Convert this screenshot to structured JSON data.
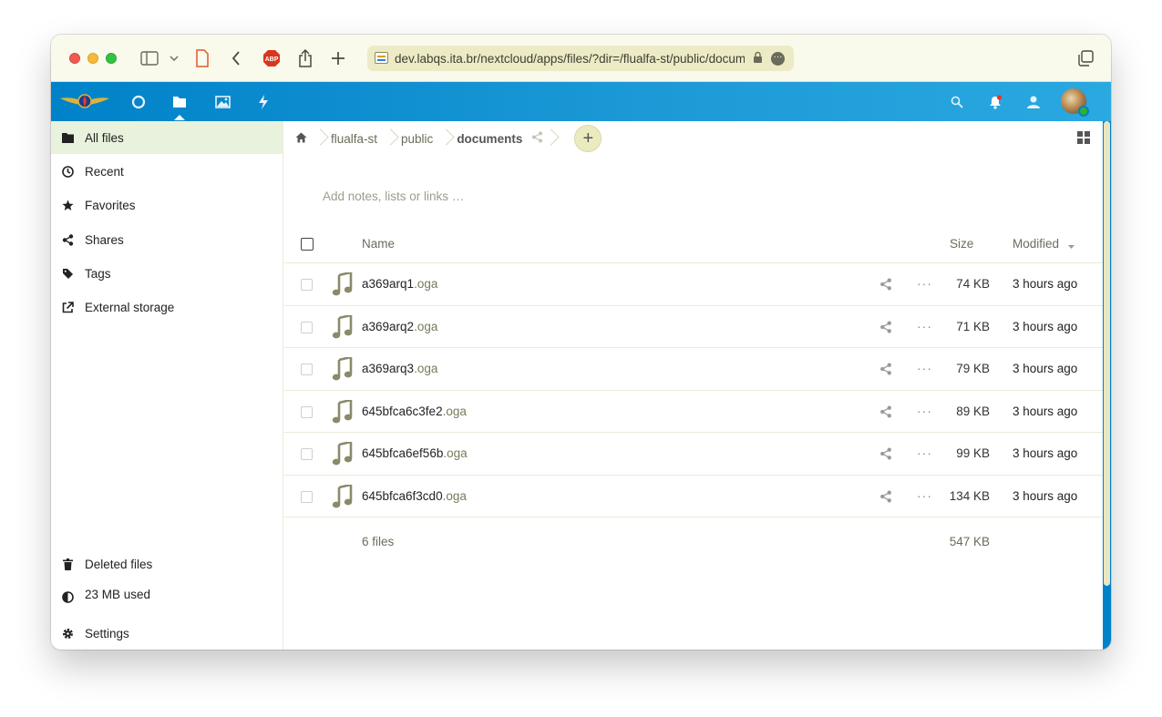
{
  "browser": {
    "url": "dev.labqs.ita.br/nextcloud/apps/files/?dir=/flualfa-st/public/documents",
    "abp_label": "ABP"
  },
  "header": {
    "apps": [
      {
        "name": "dashboard-icon"
      },
      {
        "name": "files-icon"
      },
      {
        "name": "photos-icon"
      },
      {
        "name": "activity-icon"
      }
    ]
  },
  "sidebar": {
    "items": [
      {
        "label": "All files",
        "icon": "folder-icon"
      },
      {
        "label": "Recent",
        "icon": "clock-icon"
      },
      {
        "label": "Favorites",
        "icon": "star-icon"
      },
      {
        "label": "Shares",
        "icon": "share-icon"
      },
      {
        "label": "Tags",
        "icon": "tag-icon"
      },
      {
        "label": "External storage",
        "icon": "external-link-icon"
      }
    ],
    "footer": {
      "deleted": "Deleted files",
      "quota": "23 MB used",
      "settings": "Settings"
    }
  },
  "breadcrumb": {
    "items": [
      "flualfa-st",
      "public",
      "documents"
    ]
  },
  "notes_placeholder": "Add notes, lists or links …",
  "table": {
    "headers": {
      "name": "Name",
      "size": "Size",
      "modified": "Modified"
    },
    "rows": [
      {
        "base": "a369arq1",
        "ext": ".oga",
        "size": "74 KB",
        "modified": "3 hours ago"
      },
      {
        "base": "a369arq2",
        "ext": ".oga",
        "size": "71 KB",
        "modified": "3 hours ago"
      },
      {
        "base": "a369arq3",
        "ext": ".oga",
        "size": "79 KB",
        "modified": "3 hours ago"
      },
      {
        "base": "645bfca6c3fe2",
        "ext": ".oga",
        "size": "89 KB",
        "modified": "3 hours ago"
      },
      {
        "base": "645bfca6ef56b",
        "ext": ".oga",
        "size": "99 KB",
        "modified": "3 hours ago"
      },
      {
        "base": "645bfca6f3cd0",
        "ext": ".oga",
        "size": "134 KB",
        "modified": "3 hours ago"
      }
    ],
    "summary": {
      "count": "6 files",
      "total": "547 KB"
    }
  },
  "colors": {
    "header": "#0082c9",
    "active_nav": "#e8f2dc",
    "toolbar": "#f9f9ec",
    "audio_icon": "#8a8a6a"
  }
}
